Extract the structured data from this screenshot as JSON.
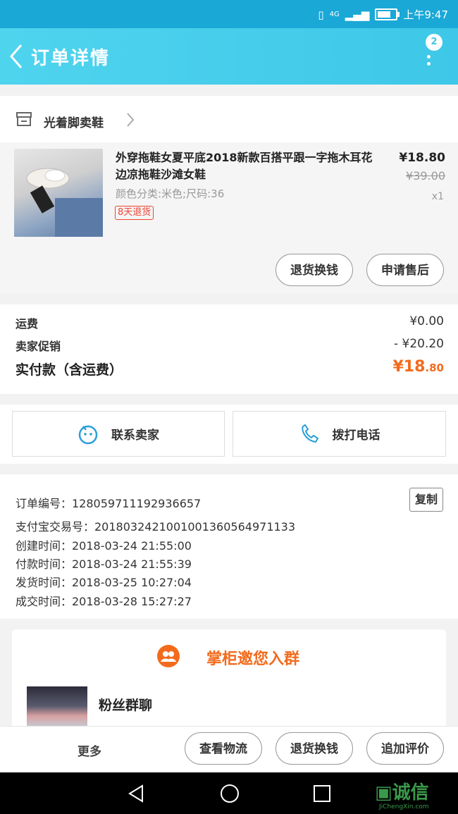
{
  "status_bar": {
    "network": "4G",
    "battery_level": 0.75,
    "time": "上午9:47"
  },
  "header": {
    "title": "订单详情",
    "badge_count": "2"
  },
  "shop": {
    "name": "光着脚卖鞋"
  },
  "product": {
    "title": "外穿拖鞋女夏平底2018新款百搭平跟一字拖木耳花边凉拖鞋沙滩女鞋",
    "sku": "颜色分类:米色;尺码:36",
    "tag": "8天退货",
    "price": "¥18.80",
    "original_price": "¥39.00",
    "quantity": "x1",
    "buttons": {
      "exchange": "退货换钱",
      "after_sale": "申请售后"
    }
  },
  "fees": {
    "shipping_label": "运费",
    "shipping_value": "¥0.00",
    "promo_label": "卖家促销",
    "promo_value": "- ¥20.20",
    "total_label": "实付款（含运费）",
    "total_currency_int": "¥18",
    "total_decimal": ".80"
  },
  "contact": {
    "seller": "联系卖家",
    "phone": "拨打电话"
  },
  "order_info": {
    "order_no": "订单编号：128059711192936657",
    "alipay_no": "支付宝交易号：2018032421001001360564971133",
    "created": "创建时间：2018-03-24 21:55:00",
    "paid": "付款时间：2018-03-24 21:55:39",
    "shipped": "发货时间：2018-03-25 10:27:04",
    "completed": "成交时间：2018-03-28 15:27:27",
    "copy_label": "复制"
  },
  "group": {
    "title": "掌柜邀您入群",
    "name": "粉丝群聊"
  },
  "bottom_bar": {
    "more": "更多",
    "logistics": "查看物流",
    "exchange": "退货换钱",
    "review": "追加评价"
  },
  "watermark": {
    "brand": "诚信",
    "url": "JiChengXin.com"
  },
  "colors": {
    "header": "#3ec7e8",
    "accent": "#f26b1d",
    "tag": "#e43"
  }
}
